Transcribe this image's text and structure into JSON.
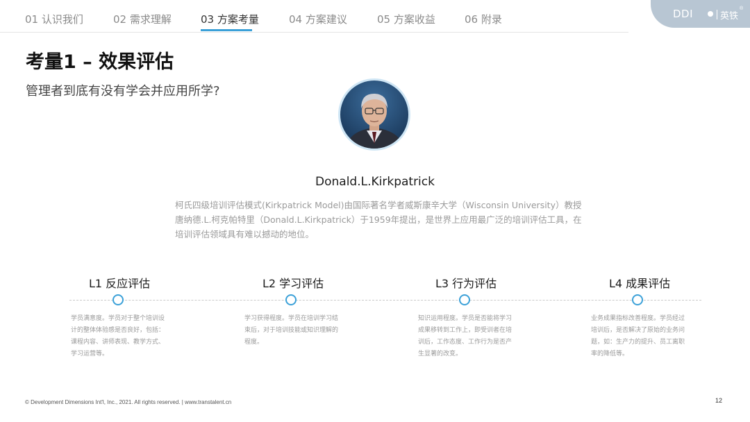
{
  "nav": {
    "items": [
      {
        "label": "01 认识我们"
      },
      {
        "label": "02 需求理解"
      },
      {
        "label": "03 方案考量"
      },
      {
        "label": "04 方案建议"
      },
      {
        "label": "05 方案收益"
      },
      {
        "label": "06 附录"
      }
    ],
    "active_index": 2
  },
  "logo": {
    "brand": "DDI",
    "cn": "英铁",
    "reg": "®"
  },
  "title": "考量1 – 效果评估",
  "subtitle": "管理者到底有没有学会并应用所学?",
  "person": {
    "name": "Donald.L.Kirkpatrick",
    "description": "柯氏四级培训评估模式(Kirkpatrick Model)由国际著名学者威斯康辛大学（Wisconsin University）教授唐纳德.L.柯克帕特里（Donald.L.Kirkpatrick）于1959年提出，是世界上应用最广泛的培训评估工具，在培训评估领域具有难以撼动的地位。"
  },
  "levels": [
    {
      "title": "L1 反应评估",
      "desc": "学员满意度。学员对于整个培训设计的整体体验感是否良好，包括：课程内容、讲师表现、教学方式、学习运营等。"
    },
    {
      "title": "L2 学习评估",
      "desc": "学习获得程度。学员在培训学习结束后，对于培训技能或知识理解的程度。"
    },
    {
      "title": "L3 行为评估",
      "desc": "知识运用程度。学员是否能将学习成果移转到工作上，即受训者在培训后，工作态度、工作行为是否产生显著的改变。"
    },
    {
      "title": "L4 成果评估",
      "desc": "业务成果指标改善程度。学员经过培训后，是否解决了原始的业务问题，如：生产力的提升、员工离职率的降低等。"
    }
  ],
  "footer": "© Development Dimensions Int'l, Inc., 2021.  All rights reserved.  |   www.transtalent.cn",
  "page_number": "12",
  "colors": {
    "accent": "#3aa0d8",
    "logo_bg": "#b8c6d3"
  }
}
